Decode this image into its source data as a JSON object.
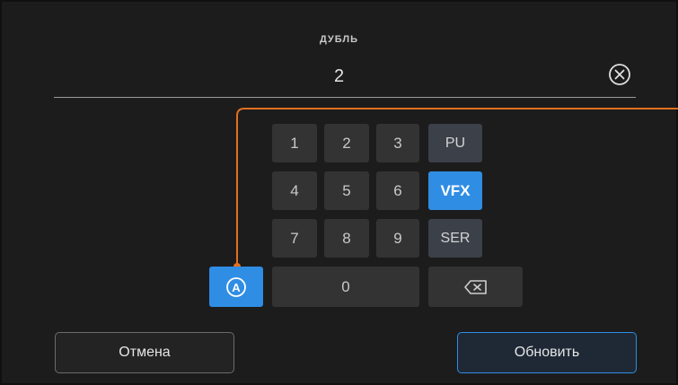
{
  "field": {
    "title": "ДУБЛЬ",
    "value": "2"
  },
  "keypad": {
    "digits": [
      "1",
      "2",
      "3",
      "4",
      "5",
      "6",
      "7",
      "8",
      "9",
      "0"
    ],
    "fn_keys": [
      "PU",
      "VFX",
      "SER"
    ],
    "active_fn": "VFX"
  },
  "icons": {
    "clear": "clear-circle-x-icon",
    "auto_mode": "circled-a-icon",
    "backspace": "backspace-icon"
  },
  "actions": {
    "cancel_label": "Отмена",
    "update_label": "Обновить"
  },
  "colors": {
    "accent": "#2f8de4",
    "callout": "#e0701f",
    "background": "#1c1c1c"
  }
}
